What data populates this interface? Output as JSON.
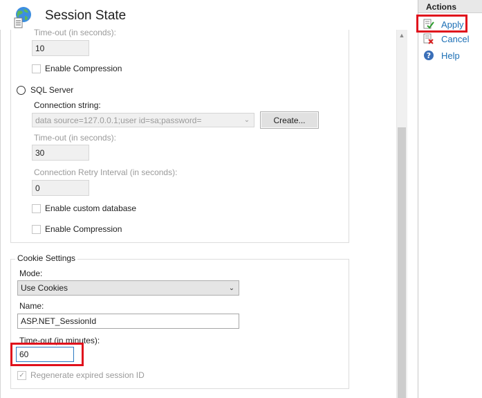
{
  "header": {
    "title": "Session State",
    "icon": "globe-document-icon"
  },
  "state_server": {
    "timeout_label": "Time-out (in seconds):",
    "timeout_value": "10",
    "compression_label": "Enable Compression",
    "compression_checked": false
  },
  "sql_server": {
    "radio_label": "SQL Server",
    "radio_selected": false,
    "connection_label": "Connection string:",
    "connection_value": "data source=127.0.0.1;user id=sa;password=",
    "create_button": "Create...",
    "timeout_label": "Time-out (in seconds):",
    "timeout_value": "30",
    "retry_label": "Connection Retry Interval (in seconds):",
    "retry_value": "0",
    "custom_db_label": "Enable custom database",
    "custom_db_checked": false,
    "compression_label": "Enable Compression",
    "compression_checked": false
  },
  "cookie_settings": {
    "legend": "Cookie Settings",
    "mode_label": "Mode:",
    "mode_value": "Use Cookies",
    "name_label": "Name:",
    "name_value": "ASP.NET_SessionId",
    "timeout_label": "Time-out (in minutes):",
    "timeout_value": "60",
    "regenerate_label": "Regenerate expired session ID",
    "regenerate_checked": true
  },
  "actions": {
    "title": "Actions",
    "items": [
      {
        "label": "Apply",
        "icon": "apply-icon"
      },
      {
        "label": "Cancel",
        "icon": "cancel-icon"
      },
      {
        "label": "Help",
        "icon": "help-icon"
      }
    ]
  },
  "colors": {
    "highlight": "#e0101c",
    "link": "#1c6fb5",
    "focus_border": "#2b79c2"
  }
}
